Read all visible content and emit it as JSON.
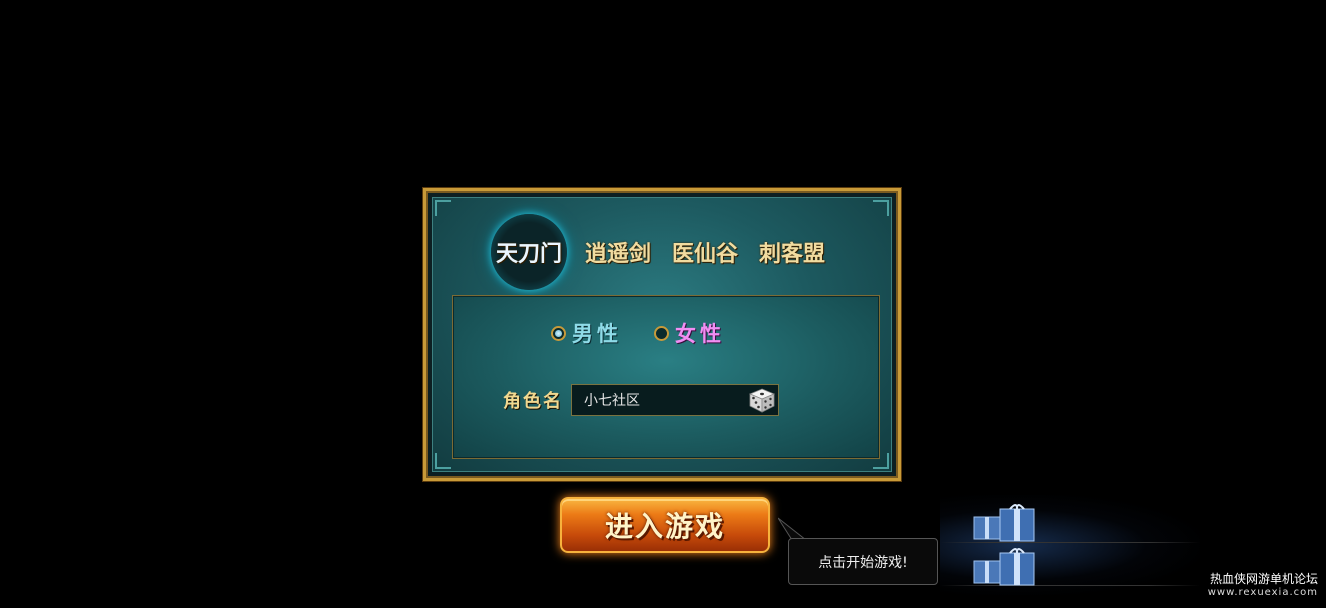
{
  "factions": {
    "tabs": [
      {
        "label": "天刀门",
        "selected": true
      },
      {
        "label": "逍遥剑",
        "selected": false
      },
      {
        "label": "医仙谷",
        "selected": false
      },
      {
        "label": "刺客盟",
        "selected": false
      }
    ]
  },
  "gender": {
    "male_label": "男性",
    "female_label": "女性",
    "selected": "male"
  },
  "character_name": {
    "label": "角色名",
    "value": "小七社区"
  },
  "enter_button": {
    "label": "进入游戏"
  },
  "tooltip": {
    "text": "点击开始游戏!"
  },
  "watermark": {
    "title": "热血侠网游单机论坛",
    "url": "www.rexuexia.com"
  },
  "colors": {
    "panel_border": "#c89a38",
    "panel_bg": "#1d5a60",
    "active_ring": "#25c6e0",
    "male": "#8fdbe8",
    "female": "#f08ef2",
    "button": "#ec7a16"
  }
}
